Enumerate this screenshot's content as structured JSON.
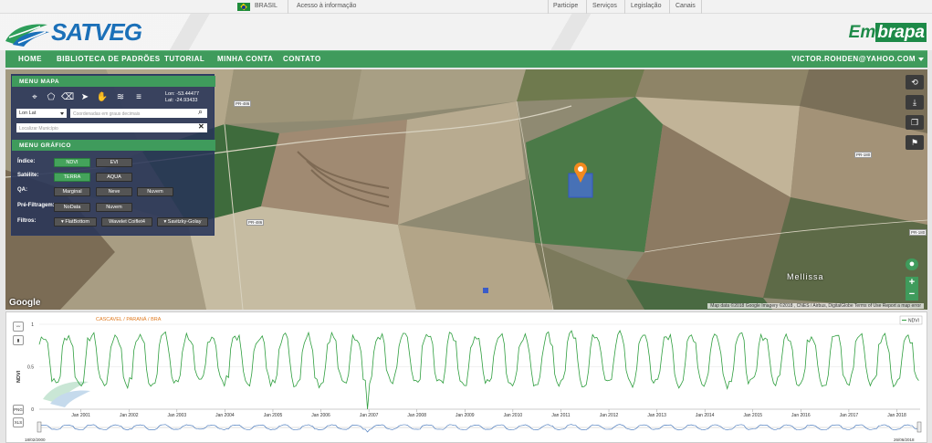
{
  "govbar": {
    "country": "BRASIL",
    "info": "Acesso à informação",
    "links": [
      "Participe",
      "Serviços",
      "Legislação",
      "Canais"
    ]
  },
  "header": {
    "logo_text_a": "SAT",
    "logo_text_b": "VEG",
    "partner_a": "Em",
    "partner_b": "brapa"
  },
  "nav": {
    "items": [
      "HOME",
      "BIBLIOTECA DE PADRÕES",
      "TUTORIAL",
      "MINHA CONTA",
      "CONTATO"
    ],
    "user": "VICTOR.ROHDEN@YAHOO.COM"
  },
  "map": {
    "google": "Google",
    "attribution": "Map data ©2018 Google Imagery ©2018 , CNES / Airbus, DigitalGlobe   Terms of Use   Report a map error",
    "places": [
      "Mellissa",
      "Cascavel"
    ],
    "roads": [
      "PR-486",
      "PR-180",
      "PR-486",
      "PR-180"
    ],
    "buttons": [
      "history-icon",
      "download-icon",
      "copy-icon",
      "flag-icon"
    ]
  },
  "menu_mapa": {
    "title": "MENU MAPA",
    "lon": "Lon: -53.44477",
    "lat": "Lat: -24.93433",
    "coord_select": "Lon Lat",
    "coord_placeholder": "Coordenadas em graus decimais",
    "municipio_placeholder": "Localizar Município"
  },
  "menu_grafico": {
    "title": "MENU GRÁFICO",
    "indice_label": "Índice:",
    "indice": [
      "NDVI",
      "EVI"
    ],
    "satelite_label": "Satélite:",
    "satelite": [
      "TERRA",
      "AQUA"
    ],
    "qa_label": "QA:",
    "qa": [
      "Marginal",
      "Neve",
      "Nuvem"
    ],
    "pre_label": "Pré-Filtragem:",
    "pre": [
      "NoData",
      "Nuvem"
    ],
    "filtros_label": "Filtros:",
    "filtros": [
      "▾ FlatBottom",
      "Wavelet Coiflet4",
      "▾ Savitzky-Golay"
    ]
  },
  "chart_data": {
    "type": "line",
    "title": "CASCAVEL / PARANÁ / BRA",
    "ylabel": "NDVI",
    "legend": "NDVI",
    "ylim": [
      0,
      1
    ],
    "yticks": [
      "0",
      "0.5",
      "1"
    ],
    "xticks": [
      "Jan 2001",
      "Jan 2002",
      "Jan 2003",
      "Jan 2004",
      "Jan 2005",
      "Jan 2006",
      "Jan 2007",
      "Jan 2008",
      "Jan 2009",
      "Jan 2010",
      "Jan 2011",
      "Jan 2012",
      "Jan 2013",
      "Jan 2014",
      "Jan 2015",
      "Jan 2016",
      "Jan 2017",
      "Jan 2018"
    ],
    "range_start": "18/02/2000",
    "range_end": "26/06/2018",
    "series": [
      {
        "name": "NDVI",
        "color": "#2e9e3e",
        "peak_mean": 0.87,
        "trough_mean": 0.3,
        "cycles_per_year": 2,
        "dropout_value": 0.0
      }
    ]
  },
  "chart_controls": [
    "PNG",
    "XLS"
  ]
}
